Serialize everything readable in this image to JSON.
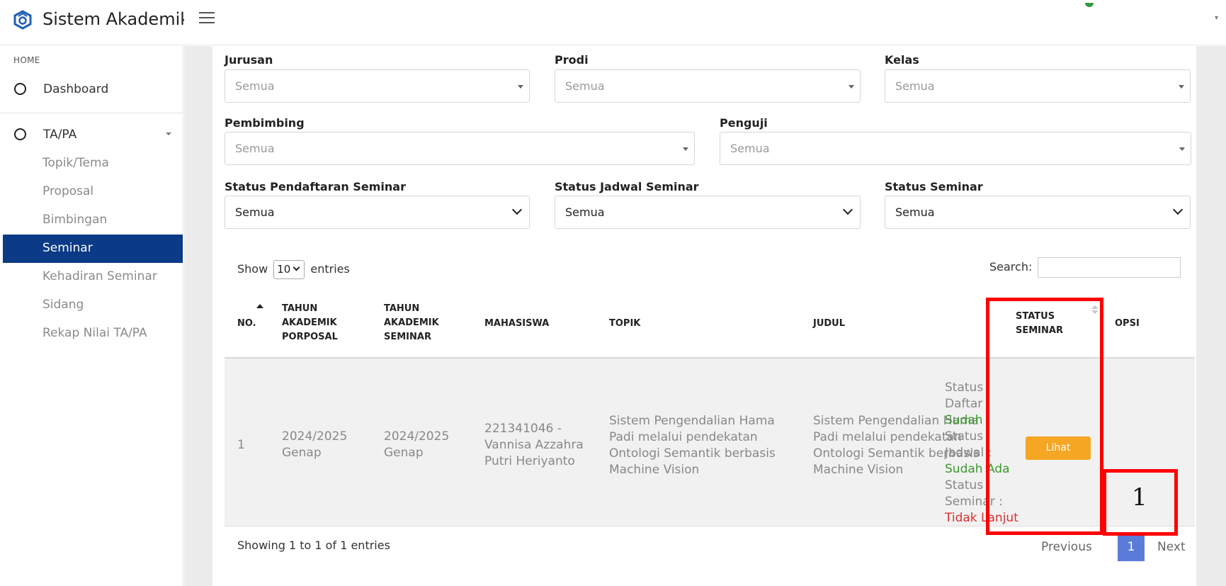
{
  "header": {
    "app_title": "Sistem Akademik"
  },
  "sidebar": {
    "section_label": "HOME",
    "items": [
      {
        "label": "Dashboard"
      },
      {
        "label": "TA/PA"
      }
    ],
    "sub_items": [
      {
        "label": "Topik/Tema"
      },
      {
        "label": "Proposal"
      },
      {
        "label": "Bimbingan"
      },
      {
        "label": "Seminar",
        "active": true
      },
      {
        "label": "Kehadiran Seminar"
      },
      {
        "label": "Sidang"
      },
      {
        "label": "Rekap Nilai TA/PA"
      }
    ]
  },
  "filters": {
    "jurusan": {
      "label": "Jurusan",
      "value": "Semua"
    },
    "prodi": {
      "label": "Prodi",
      "value": "Semua"
    },
    "kelas": {
      "label": "Kelas",
      "value": "Semua"
    },
    "pembimbing": {
      "label": "Pembimbing",
      "value": "Semua"
    },
    "penguji": {
      "label": "Penguji",
      "value": "Semua"
    },
    "status_pendaftaran": {
      "label": "Status Pendaftaran Seminar",
      "value": "Semua"
    },
    "status_jadwal": {
      "label": "Status Jadwal Seminar",
      "value": "Semua"
    },
    "status_seminar": {
      "label": "Status Seminar",
      "value": "Semua"
    }
  },
  "table_controls": {
    "show_label": "Show",
    "entries_label": "entries",
    "page_length": "10",
    "search_label": "Search:",
    "search_value": ""
  },
  "table": {
    "headers": {
      "no": "NO.",
      "tahun_proposal": [
        "TAHUN",
        "AKADEMIK",
        "PORPOSAL"
      ],
      "tahun_seminar": [
        "TAHUN",
        "AKADEMIK",
        "SEMINAR"
      ],
      "mahasiswa": "MAHASISWA",
      "topik": "TOPIK",
      "judul": "JUDUL",
      "status": [
        "STATUS",
        "SEMINAR"
      ],
      "opsi": "OPSI"
    },
    "rows": [
      {
        "no": "1",
        "tahun_proposal": [
          "2024/2025",
          "Genap"
        ],
        "tahun_seminar": [
          "2024/2025",
          "Genap"
        ],
        "mahasiswa": [
          "221341046 -",
          "Vannisa Azzahra",
          "Putri Heriyanto"
        ],
        "topik": [
          "Sistem Pengendalian Hama",
          "Padi melalui pendekatan",
          "Ontologi Semantik berbasis",
          "Machine Vision"
        ],
        "judul": [
          "Sistem Pengendalian Hama",
          "Padi melalui pendekatan",
          "Ontologi Semantik berbasis",
          "Machine Vision"
        ],
        "status": {
          "daftar_label": [
            "Status",
            "Daftar :"
          ],
          "daftar_value": "Sudah",
          "jadwal_label": [
            "Status",
            "Jadwal :"
          ],
          "jadwal_value": "Sudah Ada",
          "seminar_label": [
            "Status",
            "Seminar :"
          ],
          "seminar_value": "Tidak Lanjut"
        },
        "action_label": "Lihat"
      }
    ]
  },
  "pagination": {
    "info": "Showing 1 to 1 of 1 entries",
    "previous": "Previous",
    "current": "1",
    "next": "Next"
  },
  "annotation": {
    "label": "1"
  },
  "colors": {
    "active_nav": "#0b3a86",
    "action_button": "#f5a623",
    "page_current": "#5b7bd8",
    "status_positive": "#3a9a2a",
    "status_negative": "#e03030",
    "highlight": "#ff0000"
  }
}
